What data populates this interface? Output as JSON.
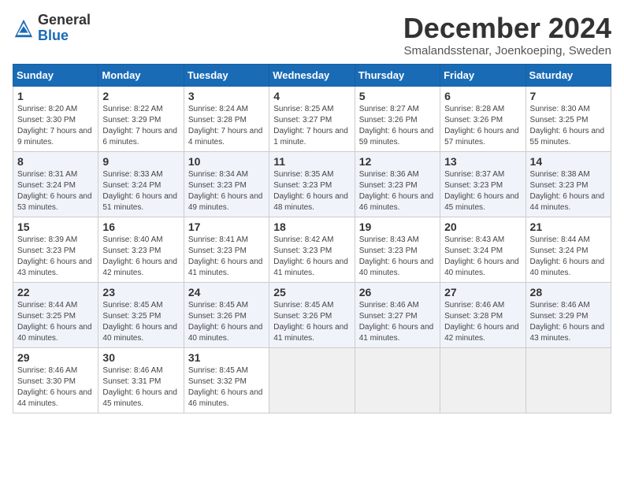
{
  "header": {
    "logo_general": "General",
    "logo_blue": "Blue",
    "month_title": "December 2024",
    "location": "Smalandsstenar, Joenkoeping, Sweden"
  },
  "weekdays": [
    "Sunday",
    "Monday",
    "Tuesday",
    "Wednesday",
    "Thursday",
    "Friday",
    "Saturday"
  ],
  "weeks": [
    [
      {
        "day": "1",
        "sunrise": "8:20 AM",
        "sunset": "3:30 PM",
        "daylight": "7 hours and 9 minutes."
      },
      {
        "day": "2",
        "sunrise": "8:22 AM",
        "sunset": "3:29 PM",
        "daylight": "7 hours and 6 minutes."
      },
      {
        "day": "3",
        "sunrise": "8:24 AM",
        "sunset": "3:28 PM",
        "daylight": "7 hours and 4 minutes."
      },
      {
        "day": "4",
        "sunrise": "8:25 AM",
        "sunset": "3:27 PM",
        "daylight": "7 hours and 1 minute."
      },
      {
        "day": "5",
        "sunrise": "8:27 AM",
        "sunset": "3:26 PM",
        "daylight": "6 hours and 59 minutes."
      },
      {
        "day": "6",
        "sunrise": "8:28 AM",
        "sunset": "3:26 PM",
        "daylight": "6 hours and 57 minutes."
      },
      {
        "day": "7",
        "sunrise": "8:30 AM",
        "sunset": "3:25 PM",
        "daylight": "6 hours and 55 minutes."
      }
    ],
    [
      {
        "day": "8",
        "sunrise": "8:31 AM",
        "sunset": "3:24 PM",
        "daylight": "6 hours and 53 minutes."
      },
      {
        "day": "9",
        "sunrise": "8:33 AM",
        "sunset": "3:24 PM",
        "daylight": "6 hours and 51 minutes."
      },
      {
        "day": "10",
        "sunrise": "8:34 AM",
        "sunset": "3:23 PM",
        "daylight": "6 hours and 49 minutes."
      },
      {
        "day": "11",
        "sunrise": "8:35 AM",
        "sunset": "3:23 PM",
        "daylight": "6 hours and 48 minutes."
      },
      {
        "day": "12",
        "sunrise": "8:36 AM",
        "sunset": "3:23 PM",
        "daylight": "6 hours and 46 minutes."
      },
      {
        "day": "13",
        "sunrise": "8:37 AM",
        "sunset": "3:23 PM",
        "daylight": "6 hours and 45 minutes."
      },
      {
        "day": "14",
        "sunrise": "8:38 AM",
        "sunset": "3:23 PM",
        "daylight": "6 hours and 44 minutes."
      }
    ],
    [
      {
        "day": "15",
        "sunrise": "8:39 AM",
        "sunset": "3:23 PM",
        "daylight": "6 hours and 43 minutes."
      },
      {
        "day": "16",
        "sunrise": "8:40 AM",
        "sunset": "3:23 PM",
        "daylight": "6 hours and 42 minutes."
      },
      {
        "day": "17",
        "sunrise": "8:41 AM",
        "sunset": "3:23 PM",
        "daylight": "6 hours and 41 minutes."
      },
      {
        "day": "18",
        "sunrise": "8:42 AM",
        "sunset": "3:23 PM",
        "daylight": "6 hours and 41 minutes."
      },
      {
        "day": "19",
        "sunrise": "8:43 AM",
        "sunset": "3:23 PM",
        "daylight": "6 hours and 40 minutes."
      },
      {
        "day": "20",
        "sunrise": "8:43 AM",
        "sunset": "3:24 PM",
        "daylight": "6 hours and 40 minutes."
      },
      {
        "day": "21",
        "sunrise": "8:44 AM",
        "sunset": "3:24 PM",
        "daylight": "6 hours and 40 minutes."
      }
    ],
    [
      {
        "day": "22",
        "sunrise": "8:44 AM",
        "sunset": "3:25 PM",
        "daylight": "6 hours and 40 minutes."
      },
      {
        "day": "23",
        "sunrise": "8:45 AM",
        "sunset": "3:25 PM",
        "daylight": "6 hours and 40 minutes."
      },
      {
        "day": "24",
        "sunrise": "8:45 AM",
        "sunset": "3:26 PM",
        "daylight": "6 hours and 40 minutes."
      },
      {
        "day": "25",
        "sunrise": "8:45 AM",
        "sunset": "3:26 PM",
        "daylight": "6 hours and 41 minutes."
      },
      {
        "day": "26",
        "sunrise": "8:46 AM",
        "sunset": "3:27 PM",
        "daylight": "6 hours and 41 minutes."
      },
      {
        "day": "27",
        "sunrise": "8:46 AM",
        "sunset": "3:28 PM",
        "daylight": "6 hours and 42 minutes."
      },
      {
        "day": "28",
        "sunrise": "8:46 AM",
        "sunset": "3:29 PM",
        "daylight": "6 hours and 43 minutes."
      }
    ],
    [
      {
        "day": "29",
        "sunrise": "8:46 AM",
        "sunset": "3:30 PM",
        "daylight": "6 hours and 44 minutes."
      },
      {
        "day": "30",
        "sunrise": "8:46 AM",
        "sunset": "3:31 PM",
        "daylight": "6 hours and 45 minutes."
      },
      {
        "day": "31",
        "sunrise": "8:45 AM",
        "sunset": "3:32 PM",
        "daylight": "6 hours and 46 minutes."
      },
      null,
      null,
      null,
      null
    ]
  ]
}
